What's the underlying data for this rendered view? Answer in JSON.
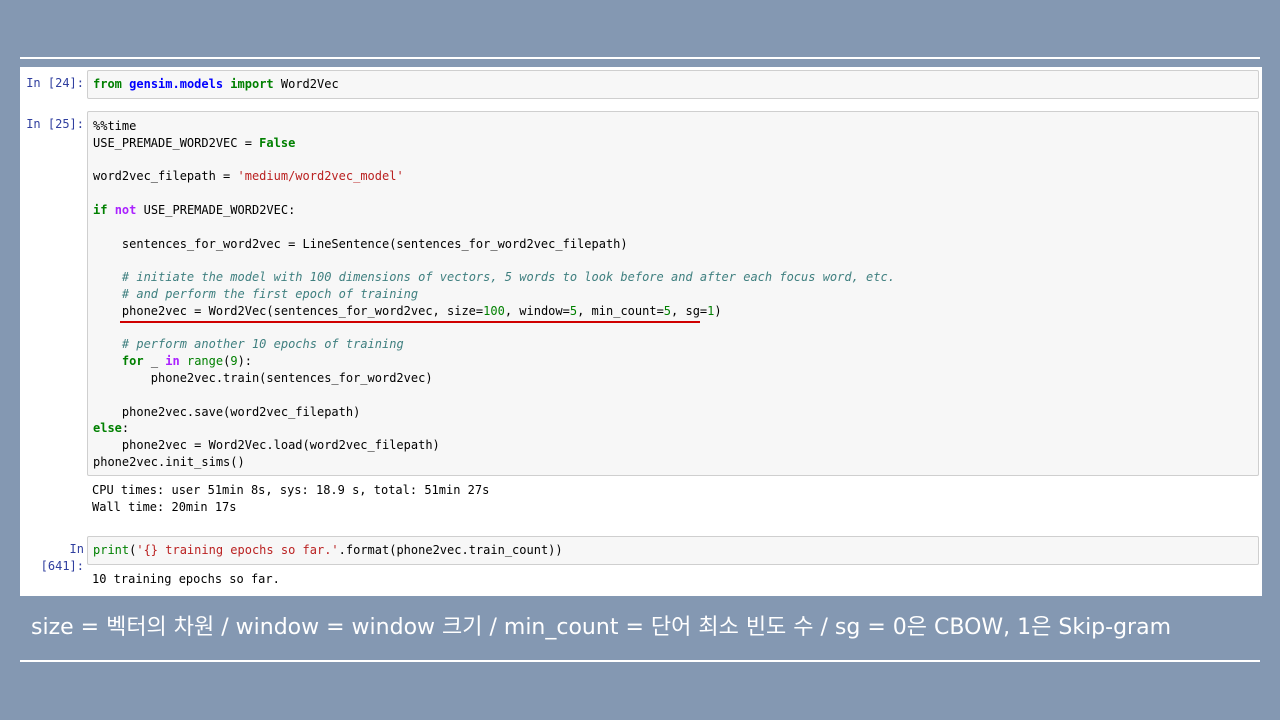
{
  "cells": [
    {
      "prompt": "In [24]:",
      "code_html": "<span class=\"kw\">from</span> <span class=\"mod\">gensim.models</span> <span class=\"kw\">import</span> Word2Vec"
    },
    {
      "prompt": "In [25]:",
      "code_html": "%%time\nUSE_PREMADE_WORD2VEC = <span class=\"kw\">False</span>\n\nword2vec_filepath = <span class=\"str\">'medium/word2vec_model'</span>\n\n<span class=\"kw\">if</span> <span class=\"kw2\">not</span> USE_PREMADE_WORD2VEC:\n\n    sentences_for_word2vec = LineSentence(sentences_for_word2vec_filepath)\n\n    <span class=\"cm\"># initiate the model with 100 dimensions of vectors, 5 words to look before and after each focus word, etc.</span>\n    <span class=\"cm\"># and perform the first epoch of training</span>\n    phone2vec = Word2Vec(sentences_for_word2vec, size=<span class=\"num\">100</span>, window=<span class=\"num\">5</span>, min_count=<span class=\"num\">5</span>, sg=<span class=\"num\">1</span>)\n\n    <span class=\"cm\"># perform another 10 epochs of training</span>\n    <span class=\"kw\">for</span> _ <span class=\"kw2\">in</span> <span class=\"bi\">range</span>(<span class=\"num\">9</span>):\n        phone2vec.train(sentences_for_word2vec)\n\n    phone2vec.save(word2vec_filepath)\n<span class=\"kw\">else</span>:\n    phone2vec = Word2Vec.load(word2vec_filepath)\nphone2vec.init_sims()",
      "output": "CPU times: user 51min 8s, sys: 18.9 s, total: 51min 27s\nWall time: 20min 17s"
    },
    {
      "prompt": "In [641]:",
      "code_html": "<span class=\"bi\">print</span>(<span class=\"str\">'{} training epochs so far.'</span>.format(phone2vec.train_count))",
      "output": "10 training epochs so far."
    }
  ],
  "caption": "size = 벡터의 차원 / window = window 크기 / min_count = 단어 최소 빈도 수 / sg = 0은 CBOW, 1은 Skip-gram",
  "colors": {
    "background": "#8498b2",
    "prompt": "#303f9f",
    "keyword": "#008000",
    "string": "#ba2121",
    "comment": "#408080",
    "highlight_underline": "#d00000"
  }
}
